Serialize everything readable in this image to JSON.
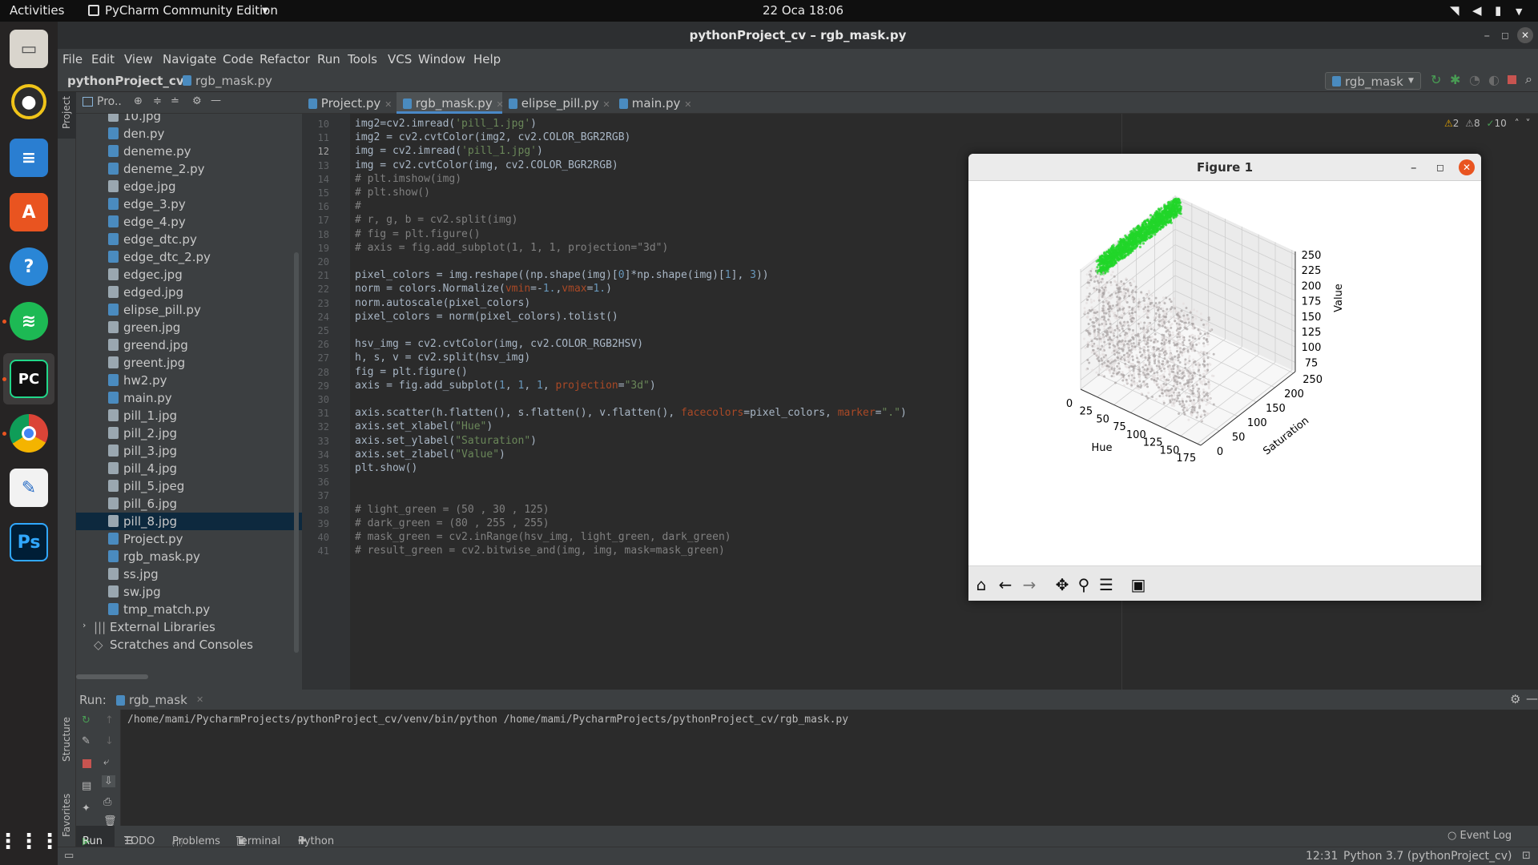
{
  "topbar": {
    "activities": "Activities",
    "app_menu": "PyCharm Community Edition",
    "clock": "22 Oca  18:06"
  },
  "window": {
    "title": "pythonProject_cv – rgb_mask.py"
  },
  "menu": [
    "File",
    "Edit",
    "View",
    "Navigate",
    "Code",
    "Refactor",
    "Run",
    "Tools",
    "VCS",
    "Window",
    "Help"
  ],
  "nav": {
    "project": "pythonProject_cv",
    "file": "rgb_mask.py",
    "run_config": "rgb_mask"
  },
  "sidebar_labels": {
    "project": "Project",
    "structure": "Structure",
    "favorites": "Favorites"
  },
  "project_panel": {
    "dropdown": "Pro..",
    "files": [
      "10.jpg",
      "den.py",
      "deneme.py",
      "deneme_2.py",
      "edge.jpg",
      "edge_3.py",
      "edge_4.py",
      "edge_dtc.py",
      "edge_dtc_2.py",
      "edgec.jpg",
      "edged.jpg",
      "elipse_pill.py",
      "green.jpg",
      "greend.jpg",
      "greent.jpg",
      "hw2.py",
      "main.py",
      "pill_1.jpg",
      "pill_2.jpg",
      "pill_3.jpg",
      "pill_4.jpg",
      "pill_5.jpeg",
      "pill_6.jpg",
      "pill_8.jpg",
      "Project.py",
      "rgb_mask.py",
      "ss.jpg",
      "sw.jpg",
      "tmp_match.py"
    ],
    "external": "External Libraries",
    "scratches": "Scratches and Consoles"
  },
  "tabs": [
    "Project.py",
    "rgb_mask.py",
    "elipse_pill.py",
    "main.py"
  ],
  "inspections": {
    "warn": "2",
    "weak": "8",
    "ok": "10"
  },
  "line_numbers": [
    "10",
    "11",
    "12",
    "13",
    "14",
    "15",
    "16",
    "17",
    "18",
    "19",
    "20",
    "21",
    "22",
    "23",
    "24",
    "25",
    "26",
    "27",
    "28",
    "29",
    "30",
    "31",
    "32",
    "33",
    "34",
    "35",
    "36",
    "37",
    "38",
    "39",
    "40",
    "41"
  ],
  "figure": {
    "title": "Figure 1",
    "toolbar_icons": [
      "home-icon",
      "back-icon",
      "forward-icon",
      "pan-icon",
      "zoom-icon",
      "configure-icon",
      "save-icon"
    ]
  },
  "chart_data": {
    "type": "scatter",
    "projection": "3d",
    "xlabel": "Hue",
    "ylabel": "Saturation",
    "zlabel": "Value",
    "xticks": [
      "0",
      "25",
      "50",
      "75",
      "100",
      "125",
      "150",
      "175"
    ],
    "yticks": [
      "0",
      "50",
      "100",
      "150",
      "200",
      "250"
    ],
    "zticks": [
      "75",
      "100",
      "125",
      "150",
      "175",
      "200",
      "225",
      "250"
    ],
    "xlim": [
      0,
      180
    ],
    "ylim": [
      0,
      255
    ],
    "zlim": [
      60,
      255
    ],
    "colors": {
      "green": "#22d62a",
      "light": "#e4dede",
      "grid": "#cfcfcf"
    }
  },
  "run": {
    "label": "Run:",
    "tab": "rgb_mask",
    "output": "/home/mami/PycharmProjects/pythonProject_cv/venv/bin/python /home/mami/PycharmProjects/pythonProject_cv/rgb_mask.py"
  },
  "bottom_tabs": [
    "Run",
    "TODO",
    "Problems",
    "Terminal",
    "Python Console"
  ],
  "status": {
    "event_log": "Event Log",
    "position": "12:31",
    "interpreter": "Python 3.7 (pythonProject_cv)"
  }
}
